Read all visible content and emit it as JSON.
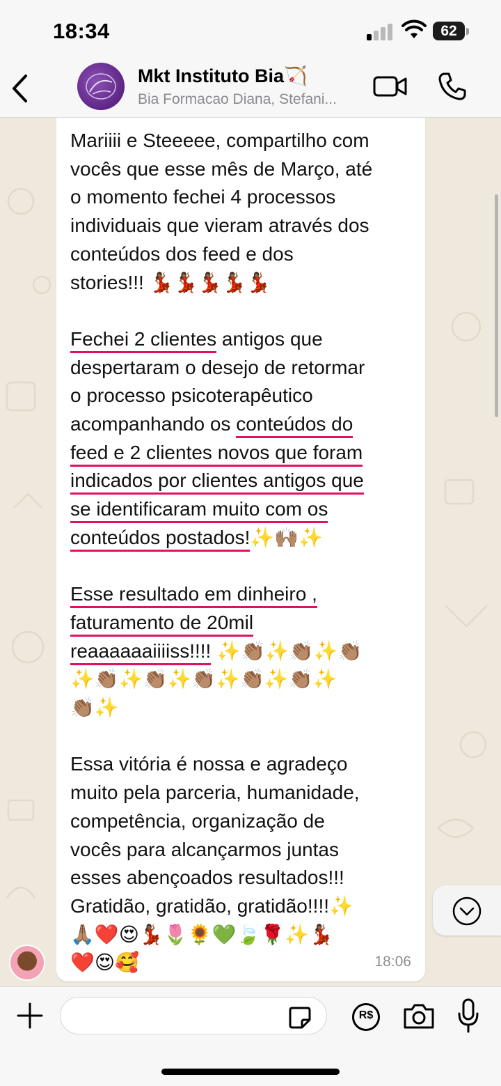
{
  "status_bar": {
    "time": "18:34",
    "battery": "62",
    "signal_icon": "signal-icon",
    "wifi_icon": "wifi-icon"
  },
  "header": {
    "back_icon": "chevron-left-icon",
    "title": "Mkt Instituto Bia🏹",
    "subtitle": "Bia Formacao Diana, Stefani...",
    "video_icon": "video-camera-icon",
    "call_icon": "phone-icon"
  },
  "message": {
    "p1": "Mariiii e Steeeee, compartilho com\nvocês que esse mês de Março, até\no momento fechei 4 processos\nindividuais que vieram através dos\nconteúdos dos feed e dos\nstories!!! 💃🏾💃🏾💃🏾💃🏾💃🏾",
    "p2_a": "Fechei 2 clientes",
    "p2_b": " antigos que\ndespertaram o desejo de retormar\no processo psicoterapêutico\nacompanhando os ",
    "p2_c": "conteúdos do",
    "p2_d": "feed e 2 clientes novos que foram",
    "p2_e": "indicados por clientes antigos que",
    "p2_f": "se identificaram muito com os",
    "p2_g": "conteúdos postados!",
    "p2_h": "✨🙌🏽✨",
    "p3_a": "Esse resultado em dinheiro ,",
    "p3_b": "faturamento de 20mil",
    "p3_c": "reaaaaaaiiiiss!!!!",
    "p3_d": " ✨👏🏽✨👏🏽✨👏🏽\n✨👏🏽✨👏🏽✨👏🏽✨👏🏽✨👏🏽✨\n👏🏽✨",
    "p4": "Essa vitória é nossa e agradeço\nmuito pela parceria, humanidade,\ncompetência, organização de\nvocês para alcançarmos juntas\nesses abençoados resultados!!!\nGratidão, gratidão, gratidão!!!!✨\n🙏🏽❤️😍💃🏾🌷🌻💚🍃🌹✨💃🏾\n❤️😍🥰",
    "time": "18:06"
  },
  "scroll_down_icon": "chevron-down-circle-icon",
  "input_bar": {
    "plus_icon": "plus-icon",
    "message_value": "",
    "sticker_icon": "sticker-icon",
    "payment_icon": "payment-icon",
    "payment_label": "R$",
    "camera_icon": "camera-icon",
    "mic_icon": "microphone-icon"
  }
}
